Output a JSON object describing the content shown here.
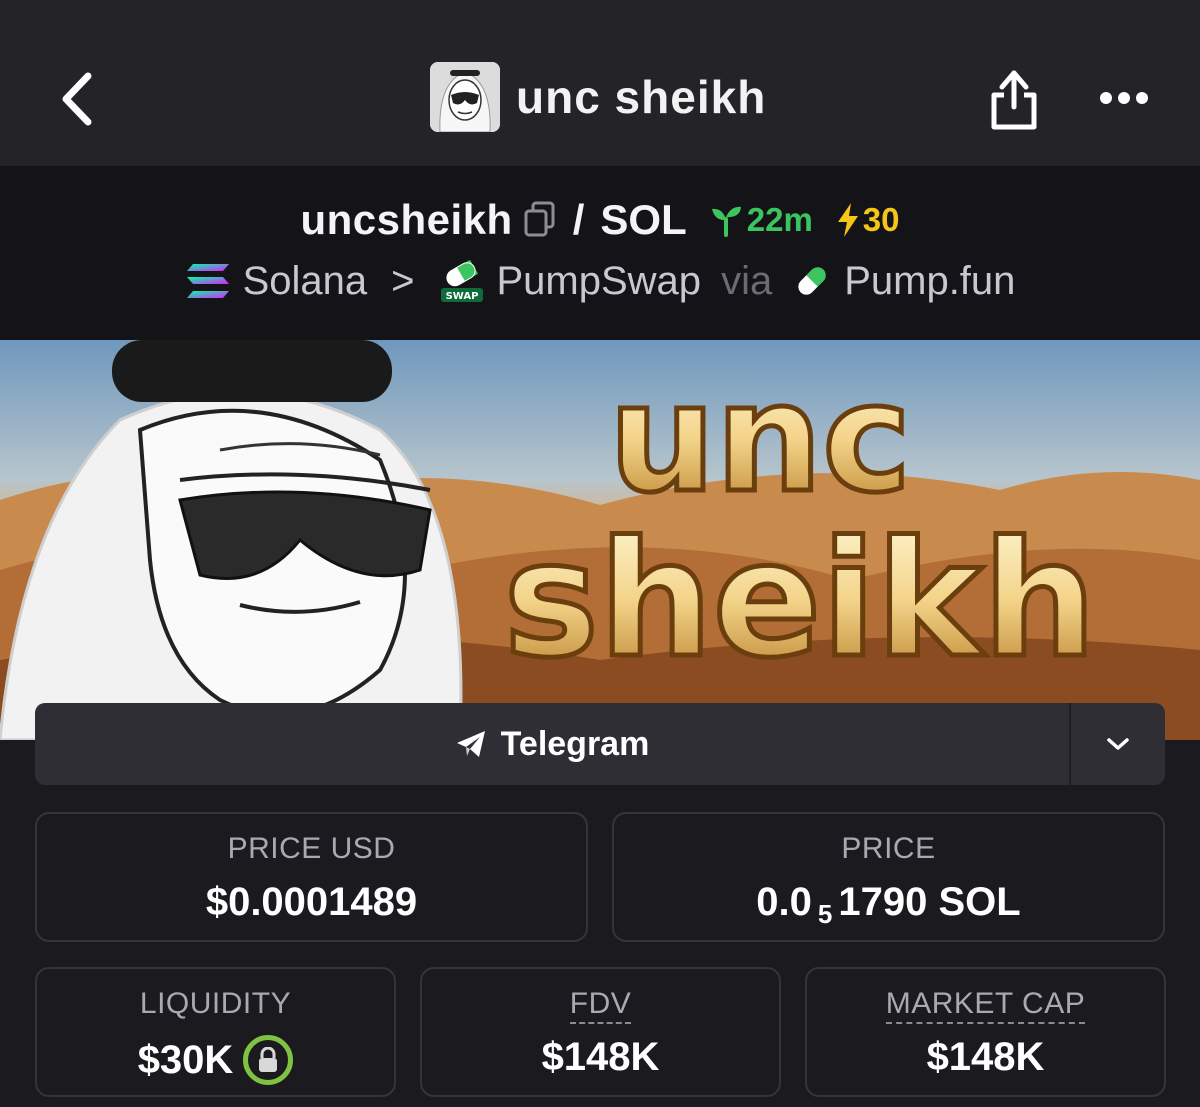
{
  "nav": {
    "title": "unc sheikh"
  },
  "pair": {
    "base": "uncsheikh",
    "separator": "/",
    "quote": "SOL",
    "age": "22m",
    "boosts": "30",
    "chain": "Solana",
    "chevron": ">",
    "dex": "PumpSwap",
    "dex_badge": "SWAP",
    "via": "via",
    "launchpad": "Pump.fun"
  },
  "banner": {
    "line1": "unc",
    "line2": "sheikh"
  },
  "social": {
    "telegram_label": "Telegram"
  },
  "stats": {
    "price_usd": {
      "label": "PRICE USD",
      "value": "$0.0001489"
    },
    "price": {
      "label": "PRICE",
      "prefix": "0.0",
      "zeros": "5",
      "rest": "1790 SOL"
    },
    "liquidity": {
      "label": "LIQUIDITY",
      "value": "$30K"
    },
    "fdv": {
      "label": "FDV",
      "value": "$148K"
    },
    "market_cap": {
      "label": "MARKET CAP",
      "value": "$148K"
    }
  },
  "colors": {
    "age_green": "#3cc55f",
    "boost_yellow": "#f5c518",
    "lock_green": "#7fc241"
  }
}
